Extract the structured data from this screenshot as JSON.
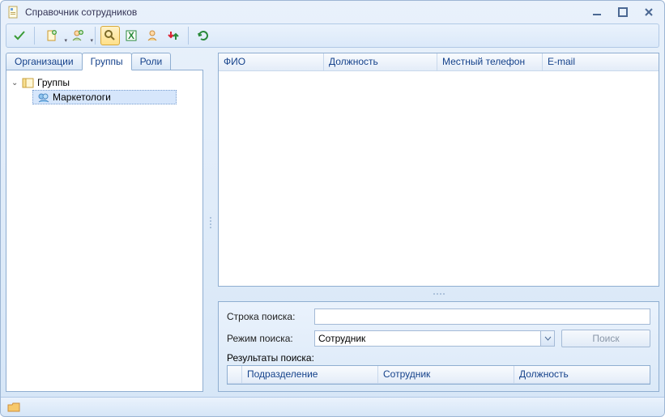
{
  "window": {
    "title": "Справочник сотрудников"
  },
  "toolbar_icons": [
    "confirm",
    "add-contact",
    "add-user",
    "search",
    "excel",
    "user-card",
    "reorder",
    "refresh"
  ],
  "tabs": {
    "org": "Организации",
    "groups": "Группы",
    "roles": "Роли",
    "active": "groups"
  },
  "tree": {
    "root_label": "Группы",
    "child_label": "Маркетологи"
  },
  "main_grid": {
    "columns": [
      "ФИО",
      "Должность",
      "Местный телефон",
      "E-mail"
    ],
    "rows": []
  },
  "search": {
    "string_label": "Строка поиска:",
    "mode_label": "Режим поиска:",
    "mode_value": "Сотрудник",
    "button": "Поиск",
    "results_label": "Результаты поиска:",
    "results_columns": [
      "Подразделение",
      "Сотрудник",
      "Должность"
    ],
    "results_rows": []
  }
}
